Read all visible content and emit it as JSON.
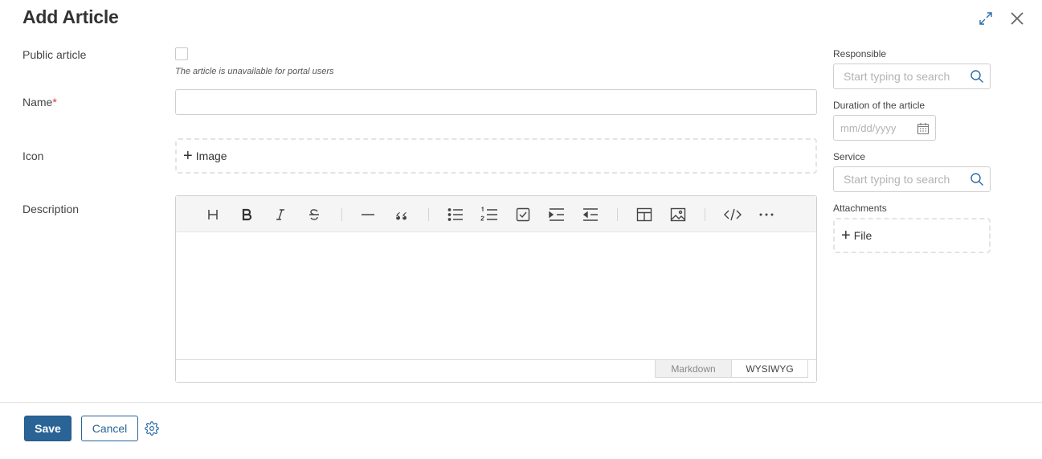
{
  "dialog": {
    "title": "Add Article"
  },
  "header_icons": {
    "expand": "expand-icon",
    "close": "close-icon"
  },
  "form": {
    "public_label": "Public article",
    "public_hint": "The article is unavailable for portal users",
    "name_label": "Name",
    "name_required_mark": "*",
    "name_value": "",
    "icon_label": "Icon",
    "image_button": "Image",
    "description_label": "Description"
  },
  "editor": {
    "toolbar": [
      "heading-icon",
      "bold-icon",
      "italic-icon",
      "strikethrough-icon",
      "horizontal-rule-icon",
      "quote-icon",
      "bullet-list-icon",
      "numbered-list-icon",
      "checklist-icon",
      "indent-icon",
      "outdent-icon",
      "table-icon",
      "image-icon",
      "code-icon",
      "more-icon"
    ],
    "tab_markdown": "Markdown",
    "tab_wysiwyg": "WYSIWYG",
    "active_tab": "WYSIWYG"
  },
  "side": {
    "responsible_label": "Responsible",
    "responsible_placeholder": "Start typing to search",
    "duration_label": "Duration of the article",
    "duration_placeholder": "mm/dd/yyyy",
    "service_label": "Service",
    "service_placeholder": "Start typing to search",
    "attachments_label": "Attachments",
    "file_button": "File"
  },
  "footer": {
    "save": "Save",
    "cancel": "Cancel",
    "settings_icon": "gear-icon"
  },
  "colors": {
    "primary": "#2a6496",
    "accent_icon": "#2c6da8",
    "required": "#d9363e"
  }
}
